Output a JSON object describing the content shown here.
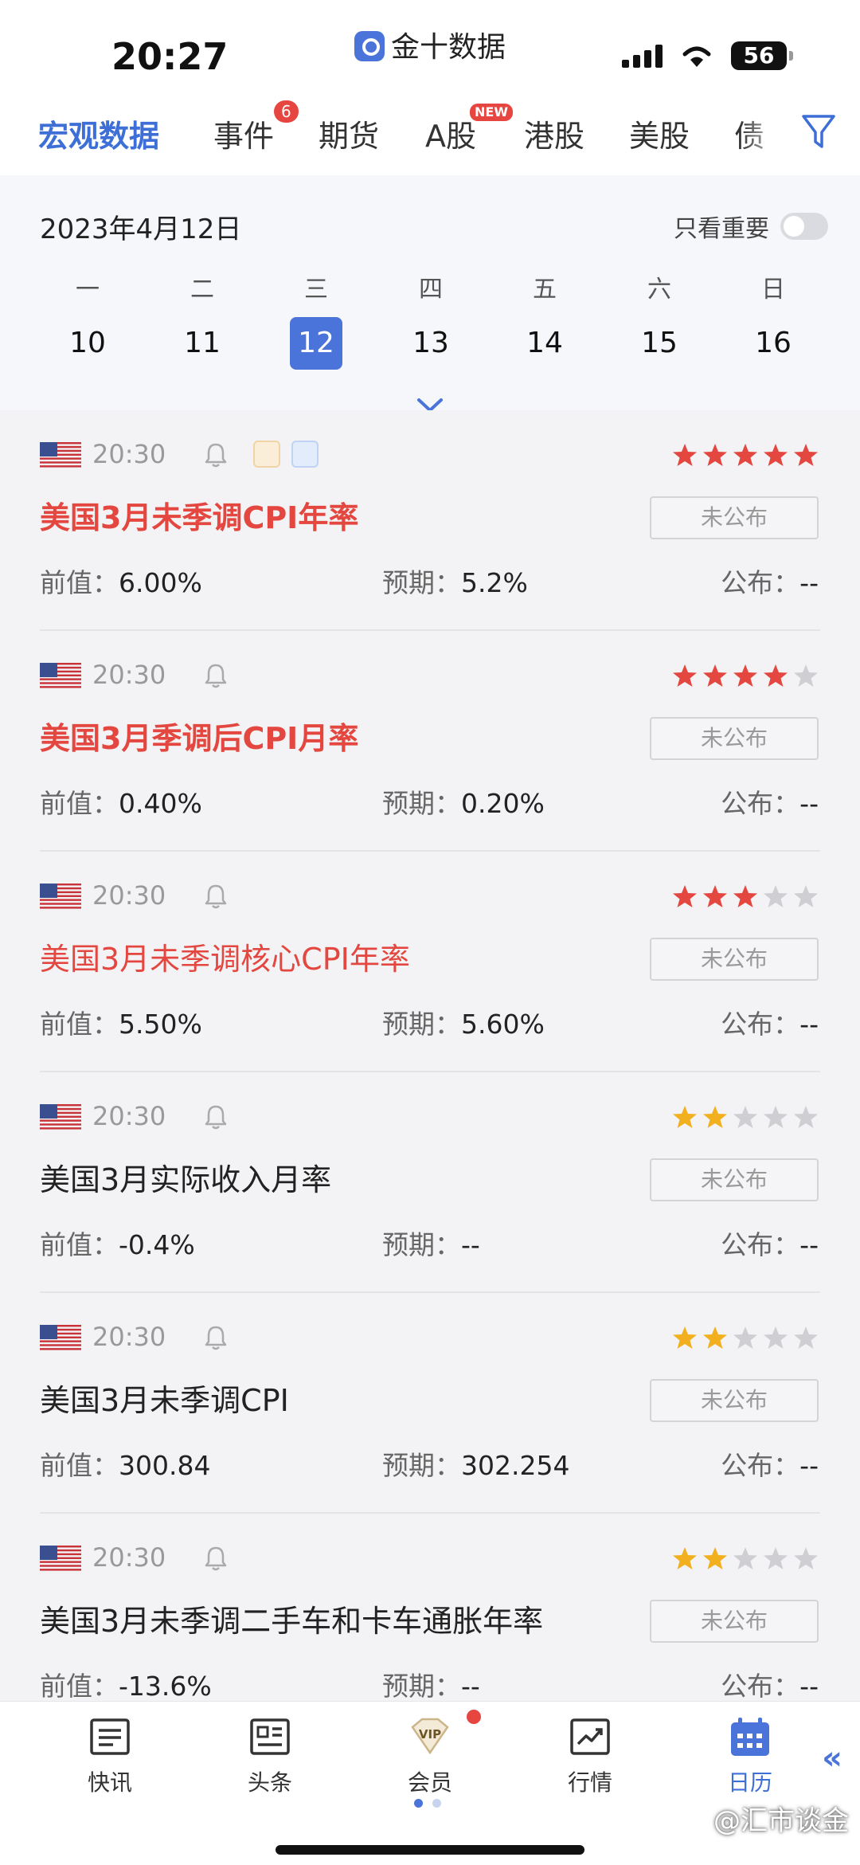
{
  "status_bar": {
    "time": "20:27",
    "app_name": "金十数据",
    "battery": "56"
  },
  "top_tabs": [
    {
      "label": "宏观数据",
      "active": true
    },
    {
      "label": "事件",
      "badge": "6"
    },
    {
      "label": "期货"
    },
    {
      "label": "A股",
      "badge": "NEW"
    },
    {
      "label": "港股"
    },
    {
      "label": "美股"
    },
    {
      "label": "债"
    }
  ],
  "calendar": {
    "date": "2023年4月12日",
    "important_only_label": "只看重要",
    "important_only_on": false,
    "weekdays": [
      "一",
      "二",
      "三",
      "四",
      "五",
      "六",
      "日"
    ],
    "days": [
      "10",
      "11",
      "12",
      "13",
      "14",
      "15",
      "16"
    ],
    "selected_day": "12"
  },
  "labels": {
    "prev": "前值：",
    "forecast": "预期：",
    "published": "公布：",
    "unpublished": "未公布"
  },
  "events": [
    {
      "time": "20:30",
      "stars": 5,
      "star_color": "#e4473f",
      "title": "美国3月未季调CPI年率",
      "style": "hl",
      "prev": "6.00%",
      "forecast": "5.2%",
      "published": "--",
      "extras": true
    },
    {
      "time": "20:30",
      "stars": 4,
      "star_color": "#e4473f",
      "title": "美国3月季调后CPI月率",
      "style": "hl",
      "prev": "0.40%",
      "forecast": "0.20%",
      "published": "--"
    },
    {
      "time": "20:30",
      "stars": 3,
      "star_color": "#e4473f",
      "title": "美国3月未季调核心CPI年率",
      "style": "hl-light",
      "prev": "5.50%",
      "forecast": "5.60%",
      "published": "--"
    },
    {
      "time": "20:30",
      "stars": 2,
      "star_color": "#f2b01e",
      "title": "美国3月实际收入月率",
      "style": "normal",
      "prev": "-0.4%",
      "forecast": "--",
      "published": "--"
    },
    {
      "time": "20:30",
      "stars": 2,
      "star_color": "#f2b01e",
      "title": "美国3月未季调CPI",
      "style": "normal",
      "prev": "300.84",
      "forecast": "302.254",
      "published": "--"
    },
    {
      "time": "20:30",
      "stars": 2,
      "star_color": "#f2b01e",
      "title": "美国3月未季调二手车和卡车通胀年率",
      "style": "normal",
      "prev": "-13.6%",
      "forecast": "--",
      "published": "--"
    }
  ],
  "bottom_nav": [
    {
      "label": "快讯",
      "icon": "newsflash-icon"
    },
    {
      "label": "头条",
      "icon": "headlines-icon"
    },
    {
      "label": "会员",
      "icon": "vip-icon"
    },
    {
      "label": "行情",
      "icon": "market-icon"
    },
    {
      "label": "日历",
      "icon": "calendar-icon",
      "active": true
    }
  ],
  "watermark": "@汇市谈金",
  "colors": {
    "accent": "#4a74d9",
    "highlight_red": "#e4473f",
    "star_gold": "#f2b01e",
    "star_off": "#cfcfd3"
  }
}
